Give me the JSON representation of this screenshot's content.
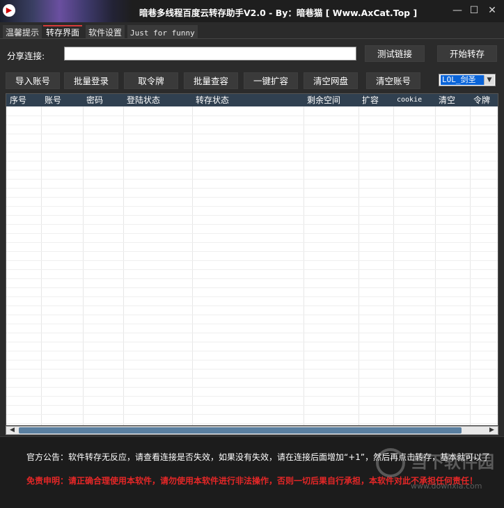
{
  "window": {
    "title": "暗巷多线程百度云转存助手V2.0 - By：暗巷猫 [ Www.AxCat.Top ]",
    "icon": "play-icon",
    "controls": [
      "minimize-icon",
      "maximize-icon",
      "close-icon"
    ]
  },
  "tabs": [
    {
      "label": "温馨提示",
      "active": false
    },
    {
      "label": "转存界面",
      "active": true
    },
    {
      "label": "软件设置",
      "active": false
    },
    {
      "label": "Just for funny",
      "active": false
    }
  ],
  "share": {
    "label": "分享连接:",
    "value": "",
    "test_button": "测试链接",
    "start_button": "开始转存"
  },
  "toolbar": {
    "import": "导入账号",
    "batch_login": "批量登录",
    "get_token": "取令牌",
    "batch_check": "批量查容",
    "expand": "一键扩容",
    "clear_disk": "清空网盘",
    "clear_accounts": "清空账号",
    "select_value": "LOL_剑圣"
  },
  "table": {
    "columns": [
      "序号",
      "账号",
      "密码",
      "登陆状态",
      "转存状态",
      "剩余空间",
      "扩容",
      "cookie",
      "清空",
      "令牌"
    ],
    "rows": []
  },
  "footer": {
    "notice": "官方公告：软件转存无反应，请查看连接是否失效，如果没有失效，请在连接后面增加“+1”，然后再点击转存，基本就可以了",
    "disclaimer": "免责申明：请正确合理使用本软件，请勿使用本软件进行非法操作，否则一切后果自行承担，本软件对此不承担任何责任！"
  },
  "watermark": {
    "text": "当下软件园",
    "url": "www.downxia.com"
  },
  "colors": {
    "background": "#2b2b2b",
    "active_tab_accent": "#d63a3a",
    "grid_header": "#304050",
    "disclaimer": "#e52727",
    "select_highlight": "#0a64d8"
  }
}
